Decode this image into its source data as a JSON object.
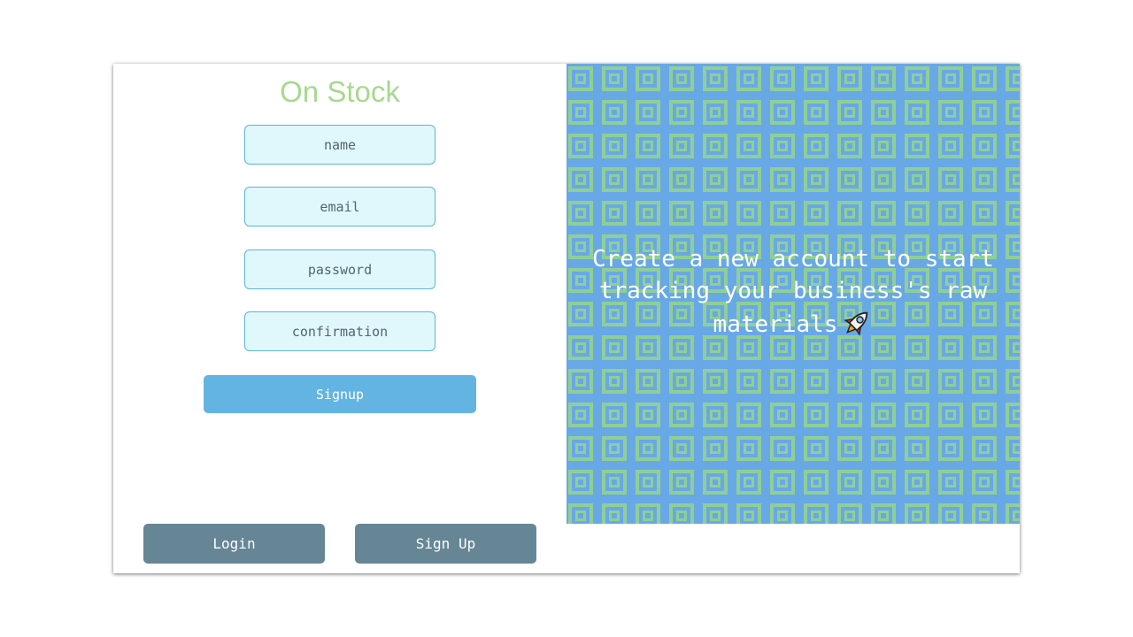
{
  "brand": {
    "title": "On Stock"
  },
  "form": {
    "name_placeholder": "name",
    "email_placeholder": "email",
    "password_placeholder": "password",
    "confirmation_placeholder": "confirmation",
    "submit_label": "Signup"
  },
  "nav": {
    "login_label": "Login",
    "signup_label": "Sign Up"
  },
  "hero": {
    "tagline": "Create a new account to start tracking your business's raw materials",
    "icon": "rocket-icon"
  },
  "colors": {
    "brand_green": "#a8d88e",
    "input_bg": "#e0f8fb",
    "input_border": "#5bb5d6",
    "submit_bg": "#63b4e3",
    "nav_button_bg": "#668695",
    "pattern_blue": "#69a8e6",
    "pattern_green": "#8fcf97"
  }
}
